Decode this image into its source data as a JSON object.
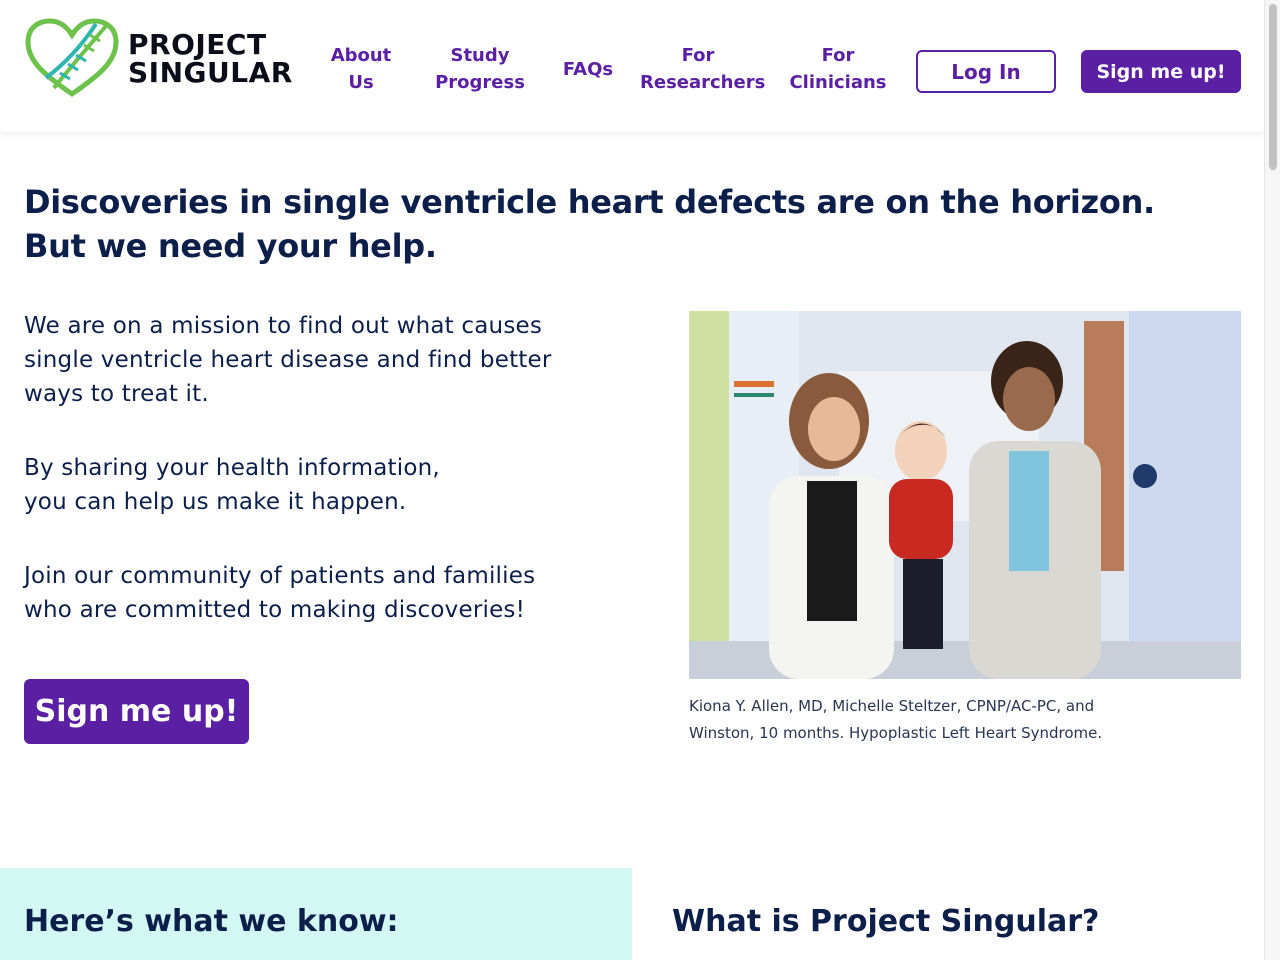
{
  "colors": {
    "primary_purple": "#5b1fa3",
    "navy_text": "#0c1f4a",
    "mint_panel": "#d3f7f2",
    "logo_green": "#6cc24a",
    "logo_teal": "#2fb5b0"
  },
  "header": {
    "logo": {
      "line1": "PROJECT",
      "line2": "SINGULAR",
      "icon": "heart-dna-logo-icon"
    },
    "nav": [
      {
        "line1": "About",
        "line2": "Us"
      },
      {
        "line1": "Study",
        "line2": "Progress"
      },
      {
        "line1": "FAQs",
        "line2": ""
      },
      {
        "line1": "For",
        "line2": "Researchers"
      },
      {
        "line1": "For",
        "line2": "Clinicians"
      }
    ],
    "login_label": "Log In",
    "signup_label": "Sign me up!"
  },
  "hero": {
    "headline_line1": "Discoveries in single ventricle heart defects are on the horizon.",
    "headline_line2": "But we need your help.",
    "p1_l1": "We are on a mission to find out what causes",
    "p1_l2": "single ventricle heart disease and find better",
    "p1_l3": "ways to treat it.",
    "p2_l1": "By sharing your health information,",
    "p2_l2": "you can help us make it happen.",
    "p3_l1": "Join our community of patients and families",
    "p3_l2": "who are committed to making discoveries!",
    "cta_label": "Sign me up!",
    "caption_l1": "Kiona Y. Allen, MD, Michelle Steltzer, CPNP/AC-PC, and",
    "caption_l2": "Winston, 10 months. Hypoplastic Left Heart Syndrome."
  },
  "sections": {
    "know_title": "Here’s what we know:",
    "what_title": "What is Project Singular?"
  }
}
